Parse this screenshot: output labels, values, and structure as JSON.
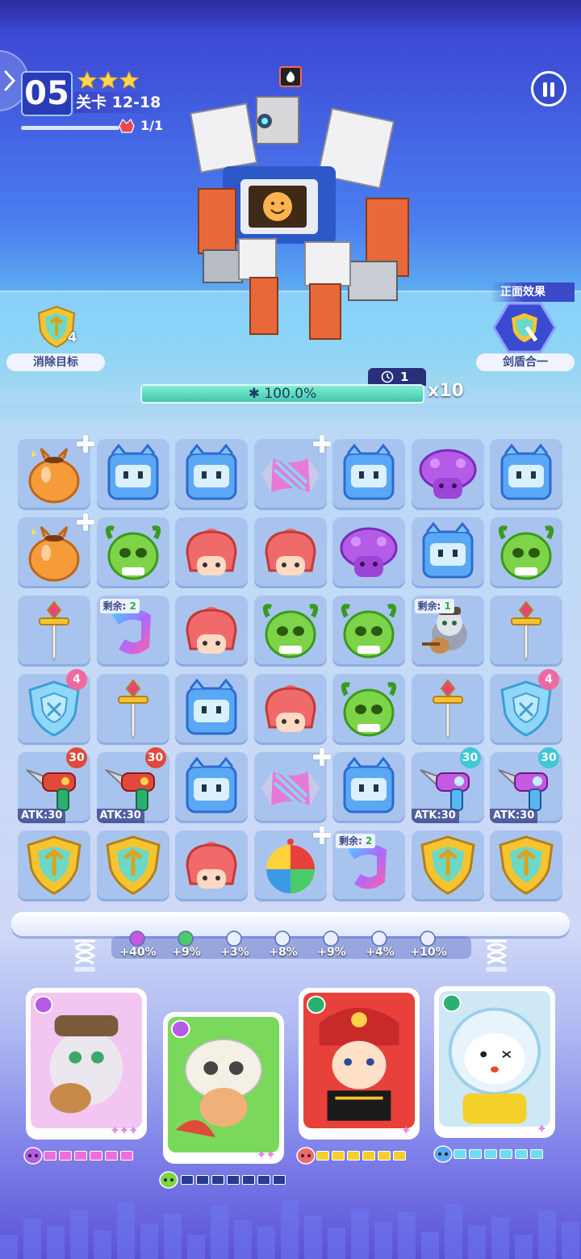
{
  "level": {
    "number": "05",
    "stage_label": "关卡 12-18",
    "stars": 3,
    "boss_count": "1/1"
  },
  "target": {
    "label": "消除目标",
    "count": "4"
  },
  "effect": {
    "title": "正面效果",
    "label": "剑盾合一"
  },
  "boss": {
    "timer": "1",
    "hp_text": "100.0%",
    "hp_fraction": 1.0,
    "multiplier": "x10"
  },
  "colors": {
    "hp": "#42c6ad",
    "pink_energy": "#ee6fd8",
    "yellow_energy": "#f4d02a",
    "cyan_energy": "#6fdcf0",
    "dark_energy": "#2a3a8e"
  },
  "board": [
    [
      {
        "icon": "pot-icon",
        "plus": true
      },
      {
        "icon": "blue-block-icon"
      },
      {
        "icon": "blue-block-icon"
      },
      {
        "icon": "candy-wrap-icon",
        "plus": true
      },
      {
        "icon": "blue-block-icon"
      },
      {
        "icon": "purple-mushroom-icon"
      },
      {
        "icon": "blue-block-icon"
      }
    ],
    [
      {
        "icon": "pot-icon",
        "plus": true
      },
      {
        "icon": "green-horned-icon"
      },
      {
        "icon": "red-helmet-icon"
      },
      {
        "icon": "red-helmet-icon"
      },
      {
        "icon": "purple-mushroom-icon"
      },
      {
        "icon": "blue-block-icon"
      },
      {
        "icon": "green-horned-icon"
      }
    ],
    [
      {
        "icon": "sword-icon"
      },
      {
        "icon": "rainbow-ribbon-icon",
        "remain_label": "剩余:",
        "remain": "2"
      },
      {
        "icon": "red-helmet-icon"
      },
      {
        "icon": "green-horned-icon"
      },
      {
        "icon": "green-horned-icon"
      },
      {
        "icon": "cat-guitar-icon",
        "remain_label": "剩余:",
        "remain": "1"
      },
      {
        "icon": "sword-icon"
      }
    ],
    [
      {
        "icon": "shield-icon",
        "badge": "4",
        "badge_color": "#f06aa0"
      },
      {
        "icon": "sword-icon"
      },
      {
        "icon": "blue-block-icon"
      },
      {
        "icon": "red-helmet-icon"
      },
      {
        "icon": "green-horned-icon"
      },
      {
        "icon": "sword-icon"
      },
      {
        "icon": "shield-icon",
        "badge": "4",
        "badge_color": "#f06aa0"
      }
    ],
    [
      {
        "icon": "red-drill-gun-icon",
        "badge": "30",
        "badge_color": "#e04a3a",
        "atk": "ATK:30"
      },
      {
        "icon": "red-drill-gun-icon",
        "badge": "30",
        "badge_color": "#e04a3a",
        "atk": "ATK:30"
      },
      {
        "icon": "blue-block-icon"
      },
      {
        "icon": "candy-wrap-icon",
        "plus": true
      },
      {
        "icon": "blue-block-icon"
      },
      {
        "icon": "ice-drill-gun-icon",
        "badge": "30",
        "badge_color": "#3ec7d8",
        "atk": "ATK:30"
      },
      {
        "icon": "ice-drill-gun-icon",
        "badge": "30",
        "badge_color": "#3ec7d8",
        "atk": "ATK:30"
      }
    ],
    [
      {
        "icon": "gold-emblem-icon"
      },
      {
        "icon": "gold-emblem-icon"
      },
      {
        "icon": "red-helmet-icon"
      },
      {
        "icon": "beach-ball-icon",
        "plus": true
      },
      {
        "icon": "rainbow-ribbon-icon",
        "remain_label": "剩余:",
        "remain": "2"
      },
      {
        "icon": "gold-emblem-icon"
      },
      {
        "icon": "gold-emblem-icon"
      }
    ]
  ],
  "bonuses": [
    "+40%",
    "+9%",
    "+3%",
    "+8%",
    "+9%",
    "+4%",
    "+10%"
  ],
  "heroes": [
    {
      "name": "cat-bard",
      "energy_filled": 6,
      "energy_total": 6,
      "color": "#ee6fd8"
    },
    {
      "name": "skull-kid",
      "energy_filled": 0,
      "energy_total": 7,
      "color": "#2a3a8e"
    },
    {
      "name": "opera-hero",
      "energy_filled": 6,
      "energy_total": 6,
      "color": "#f4d02a"
    },
    {
      "name": "astro-bear",
      "energy_filled": 6,
      "energy_total": 6,
      "color": "#6fdcf0"
    }
  ]
}
